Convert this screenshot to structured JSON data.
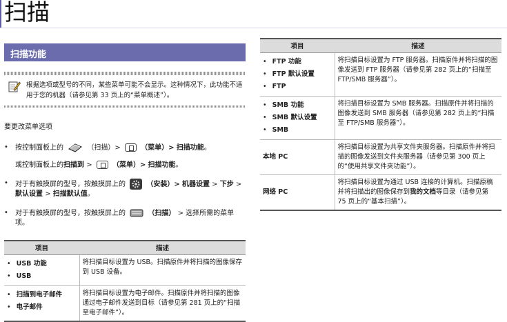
{
  "page_title": "扫描",
  "section_title": "扫描功能",
  "note_text": "根据选项或型号的不同，某些菜单可能不会显示。这种情况下，此功能不适用于您的机器（请参见第 33 页上的“菜单概述”）。",
  "intro": "要更改菜单选项",
  "steps": {
    "s1_pre": "按控制面板上的",
    "s1_scan": "（扫描）>",
    "s1_menu": "（菜单）>",
    "s1_func": "扫描功能",
    "s1_end": "。",
    "s2_pre": "或控制面板上的",
    "s2_scanto": "扫描到",
    "s2_gt": ">",
    "s2_menu": "（菜单）>",
    "s2_func": "扫描功能",
    "s2_end": "。",
    "s3_pre": "对于有触摸屏的型号，按触摸屏上的",
    "s3_setup": "（安装）>",
    "s3_machine": "机器设置",
    "s3_gt1": ">",
    "s3_next": "下步",
    "s3_gt2": ">",
    "s3_default": "默认设置",
    "s3_gt3": ">",
    "s3_scandef": "扫描默认值",
    "s3_end": "。",
    "s4_pre": "对于有触摸屏的型号，按触摸屏上的",
    "s4_scan": "（扫描）",
    "s4_rest": "> 选择所需的菜单项。"
  },
  "table_headers": {
    "item": "项目",
    "desc": "描述"
  },
  "left_table": [
    {
      "items": [
        "USB 功能",
        "USB"
      ],
      "desc": "将扫描目标设置为 USB。扫描原件并将扫描的图像保存到 USB 设备。"
    },
    {
      "items": [
        "扫描到电子邮件",
        "电子邮件"
      ],
      "desc": "将扫描目标设置为电子邮件。扫描原件并将扫描的图像通过电子邮件发送到目标（请参见第 281 页上的“扫描至电子邮件”）。"
    }
  ],
  "right_table": [
    {
      "items": [
        "FTP 功能",
        "FTP 默认设置",
        "FTP"
      ],
      "desc": "将扫描目标设置为 FTP 服务器。扫描原件并将扫描的图像发送到 FTP 服务器（请参见第 282 页上的“扫描至 FTP/SMB 服务器”）。"
    },
    {
      "items": [
        "SMB 功能",
        "SMB 默认设置",
        "SMB"
      ],
      "desc": "将扫描目标设置为 SMB 服务器。扫描原件并将扫描的图像发送到 SMB 服务器（请参见第 282 页上的“扫描至 FTP/SMB 服务器”）。"
    },
    {
      "item": "本地 PC",
      "desc": "将扫描目标设置为共享文件夹服务器。扫描原件并将扫描的图像发送到文件夹服务器（请参见第 300 页上的“使用共享文件夹功能”）。"
    },
    {
      "item": "网络 PC",
      "desc_pre": "将扫描目标设置为通过 USB 连接的计算机。扫描原稿并将扫描出的图像保存到",
      "desc_bold": "我的文档",
      "desc_post": "等目录（请参见第 75 页上的“基本扫描”）。"
    }
  ]
}
